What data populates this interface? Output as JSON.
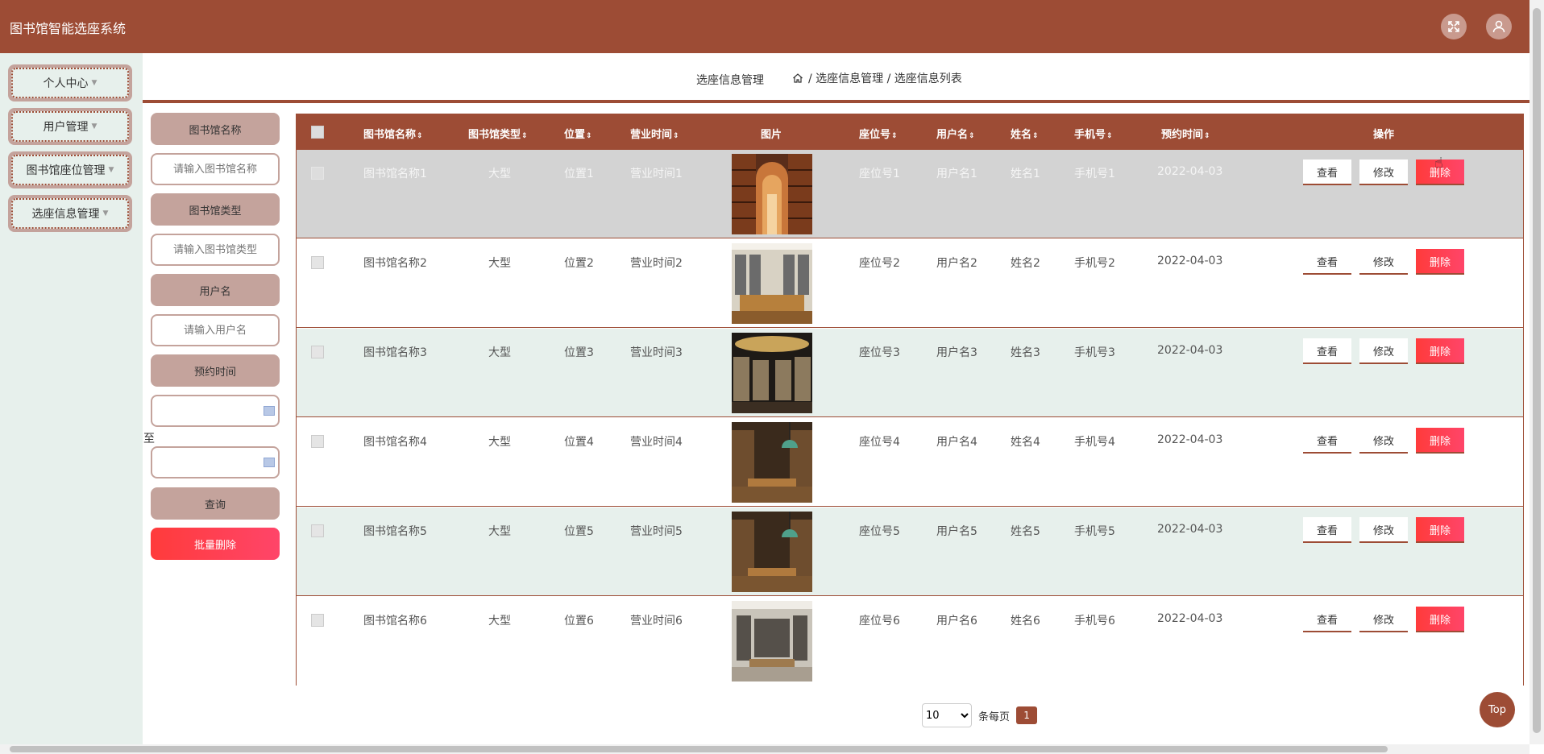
{
  "app": {
    "title": "图书馆智能选座系统"
  },
  "header": {
    "fullscreen_icon": "fullscreen-icon",
    "avatar_icon": "user-avatar-icon"
  },
  "sidebar": {
    "items": [
      {
        "label": "个人中心"
      },
      {
        "label": "用户管理"
      },
      {
        "label": "图书馆座位管理"
      },
      {
        "label": "选座信息管理"
      }
    ]
  },
  "breadcrumb": {
    "title": "选座信息管理",
    "home_icon": "home-icon",
    "path": "/ 选座信息管理 / 选座信息列表"
  },
  "search": {
    "library_name_label": "图书馆名称",
    "library_name_placeholder": "请输入图书馆名称",
    "library_type_label": "图书馆类型",
    "library_type_placeholder": "请输入图书馆类型",
    "username_label": "用户名",
    "username_placeholder": "请输入用户名",
    "reserve_time_label": "预约时间",
    "to_label": "至",
    "query_button": "查询",
    "bulk_delete_button": "批量删除"
  },
  "table": {
    "columns": [
      "图书馆名称",
      "图书馆类型",
      "位置",
      "营业时间",
      "图片",
      "座位号",
      "用户名",
      "姓名",
      "手机号",
      "预约时间",
      "操作"
    ],
    "rows": [
      {
        "name": "图书馆名称1",
        "type": "大型",
        "location": "位置1",
        "hours": "营业时间1",
        "seat": "座位号1",
        "username": "用户名1",
        "realname": "姓名1",
        "phone": "手机号1",
        "time": "2022-04-03"
      },
      {
        "name": "图书馆名称2",
        "type": "大型",
        "location": "位置2",
        "hours": "营业时间2",
        "seat": "座位号2",
        "username": "用户名2",
        "realname": "姓名2",
        "phone": "手机号2",
        "time": "2022-04-03"
      },
      {
        "name": "图书馆名称3",
        "type": "大型",
        "location": "位置3",
        "hours": "营业时间3",
        "seat": "座位号3",
        "username": "用户名3",
        "realname": "姓名3",
        "phone": "手机号3",
        "time": "2022-04-03"
      },
      {
        "name": "图书馆名称4",
        "type": "大型",
        "location": "位置4",
        "hours": "营业时间4",
        "seat": "座位号4",
        "username": "用户名4",
        "realname": "姓名4",
        "phone": "手机号4",
        "time": "2022-04-03"
      },
      {
        "name": "图书馆名称5",
        "type": "大型",
        "location": "位置5",
        "hours": "营业时间5",
        "seat": "座位号5",
        "username": "用户名5",
        "realname": "姓名5",
        "phone": "手机号5",
        "time": "2022-04-03"
      },
      {
        "name": "图书馆名称6",
        "type": "大型",
        "location": "位置6",
        "hours": "营业时间6",
        "seat": "座位号6",
        "username": "用户名6",
        "realname": "姓名6",
        "phone": "手机号6",
        "time": "2022-04-03"
      }
    ],
    "actions": {
      "view": "查看",
      "edit": "修改",
      "delete": "删除"
    }
  },
  "pagination": {
    "page_size": "10",
    "per_page_label": "条每页",
    "current_page": "1"
  },
  "back_to_top": "Top",
  "colors": {
    "primary": "#9d4c35",
    "accent_light": "#c4a39c",
    "sidebar_bg": "#e7f0ec",
    "danger": "#ff3b3b"
  }
}
